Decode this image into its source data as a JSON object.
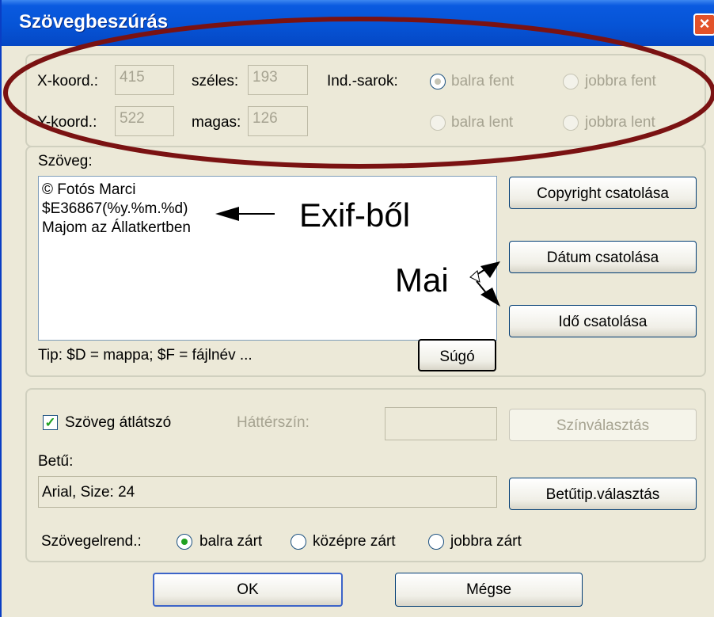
{
  "window": {
    "title": "Szövegbeszúrás",
    "close_glyph": "×"
  },
  "position": {
    "x_label": "X-koord.:",
    "x_value": "415",
    "y_label": "Y-koord.:",
    "y_value": "522",
    "width_label": "széles:",
    "width_value": "193",
    "height_label": "magas:",
    "height_value": "126",
    "corner_label": "Ind.-sarok:",
    "corner_options": [
      "balra fent",
      "jobbra fent",
      "balra lent",
      "jobbra lent"
    ],
    "corner_selected": "balra fent"
  },
  "text": {
    "label": "Szöveg:",
    "content": "© Fotós Marci\n$E36867(%y.%m.%d)\nMajom az Állatkertben",
    "tip": "Tip: $D = mappa; $F = fájlnév ...",
    "help_button": "Súgó",
    "copyright_button": "Copyright csatolása",
    "date_button": "Dátum csatolása",
    "time_button": "Idő csatolása"
  },
  "font": {
    "transparent_checkbox_label": "Szöveg átlátszó",
    "transparent_checked": true,
    "bgcolor_label": "Háttérszín:",
    "color_button": "Színválasztás",
    "font_label": "Betű:",
    "font_value": "Arial, Size: 24",
    "font_button": "Betűtip.választás",
    "align_label": "Szövegelrend.:",
    "align_options": [
      "balra zárt",
      "középre zárt",
      "jobbra zárt"
    ],
    "align_selected": "balra zárt"
  },
  "footer": {
    "ok_button": "OK",
    "cancel_button": "Mégse"
  },
  "annotations": {
    "exif": "Exif-ből",
    "mai": "Mai"
  },
  "colors": {
    "ellipse": "#7a1212",
    "title_bar": "#0a5ae0",
    "radio_dot": "#21a121"
  }
}
